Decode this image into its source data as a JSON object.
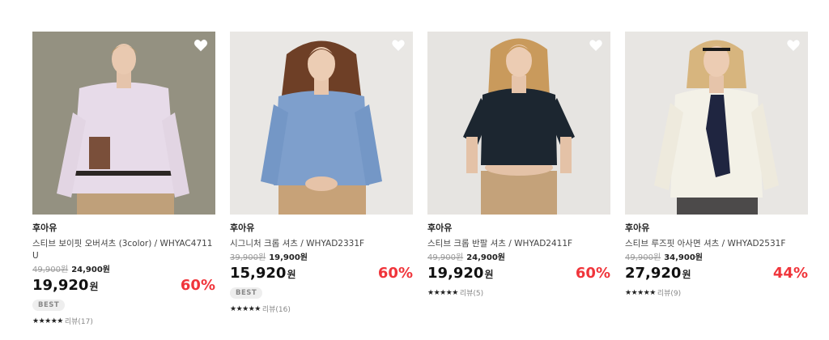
{
  "products": [
    {
      "brand": "후아유",
      "name": "스티브 보이핏 오버셔츠 (3color) / WHYAC4711U",
      "original_price": "49,900원",
      "previous_price": "24,900원",
      "price": "19,920",
      "currency": "원",
      "discount": "60%",
      "badge": "BEST",
      "stars": "★★★★★",
      "review": "리뷰(17)",
      "bg": "#8f8c7d",
      "shirt": "#e7dbe9",
      "pants": "#bfa07a",
      "hair": "#b89766"
    },
    {
      "brand": "후아유",
      "name": "시그니처 크롭 셔츠 / WHYAD2331F",
      "original_price": "39,900원",
      "previous_price": "19,900원",
      "price": "15,920",
      "currency": "원",
      "discount": "60%",
      "badge": "BEST",
      "stars": "★★★★★",
      "review": "리뷰(16)",
      "bg": "#e9e7e4",
      "shirt": "#7e9fcc",
      "pants": "#c7a278",
      "hair": "#6e3f26"
    },
    {
      "brand": "후아유",
      "name": "스티브 크롭 반팔 셔츠 / WHYAD2411F",
      "original_price": "49,900원",
      "previous_price": "24,900원",
      "price": "19,920",
      "currency": "원",
      "discount": "60%",
      "badge": "",
      "stars": "★★★★★",
      "review": "리뷰(5)",
      "bg": "#e6e4e1",
      "shirt": "#1c2630",
      "pants": "#c4a27a",
      "hair": "#c99a5c"
    },
    {
      "brand": "후아유",
      "name": "스티브 루즈핏 아사면 셔츠 / WHYAD2531F",
      "original_price": "49,900원",
      "previous_price": "34,900원",
      "price": "27,920",
      "currency": "원",
      "discount": "44%",
      "badge": "",
      "stars": "★★★★★",
      "review": "리뷰(9)",
      "bg": "#e8e6e3",
      "shirt": "#f3f1e7",
      "pants": "#4c4a4a",
      "hair": "#d7b57e"
    }
  ]
}
